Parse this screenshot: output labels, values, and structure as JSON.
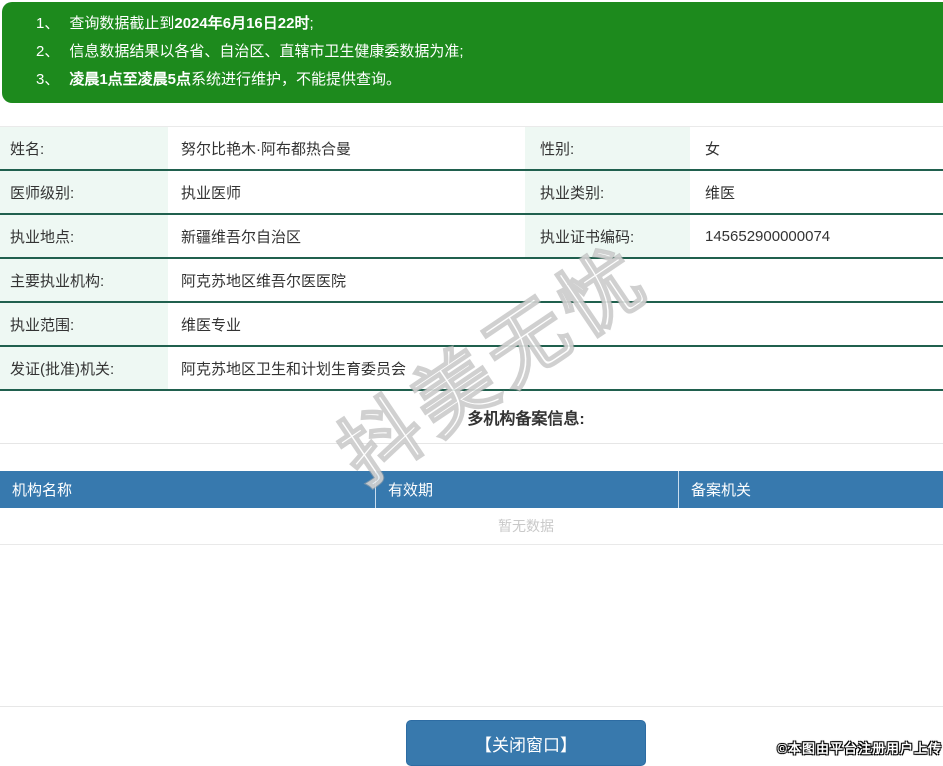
{
  "banner": {
    "lines": [
      {
        "num": "1、",
        "pre": "查询数据截止到",
        "bold": "2024年6月16日22时",
        "post": ";"
      },
      {
        "num": "2、",
        "pre": "信息数据结果以各省、自治区、直辖市卫生健康委数据为准;",
        "bold": "",
        "post": ""
      },
      {
        "num": "3、",
        "pre": "",
        "bold": "凌晨1点至凌晨5点",
        "post": "系统进行维护，不能提供查询。"
      }
    ]
  },
  "info": {
    "rows": [
      {
        "label": "姓名:",
        "value": "努尔比艳木·阿布都热合曼",
        "label2": "性别:",
        "value2": "女"
      },
      {
        "label": "医师级别:",
        "value": "执业医师",
        "label2": "执业类别:",
        "value2": "维医"
      },
      {
        "label": "执业地点:",
        "value": "新疆维吾尔自治区",
        "label2": "执业证书编码:",
        "value2": "145652900000074"
      },
      {
        "label": "主要执业机构:",
        "value": "阿克苏地区维吾尔医医院"
      },
      {
        "label": "执业范围:",
        "value": "维医专业"
      },
      {
        "label": "发证(批准)机关:",
        "value": "阿克苏地区卫生和计划生育委员会"
      }
    ]
  },
  "records": {
    "title": "多机构备案信息:",
    "columns": [
      "机构名称",
      "有效期",
      "备案机关"
    ],
    "empty_text": "暂无数据"
  },
  "footer": {
    "close_label": "【关闭窗口】"
  },
  "watermarks": {
    "diagonal": "抖美无忧",
    "corner": "©本图由平台注册用户上传"
  },
  "colors": {
    "banner_green": "#1d8a1d",
    "row_separator_teal": "#20604e",
    "label_mint": "#eef8f3",
    "table_header_blue": "#3779ae",
    "button_blue": "#3879ad",
    "empty_text_gray": "#c9c9c9"
  }
}
